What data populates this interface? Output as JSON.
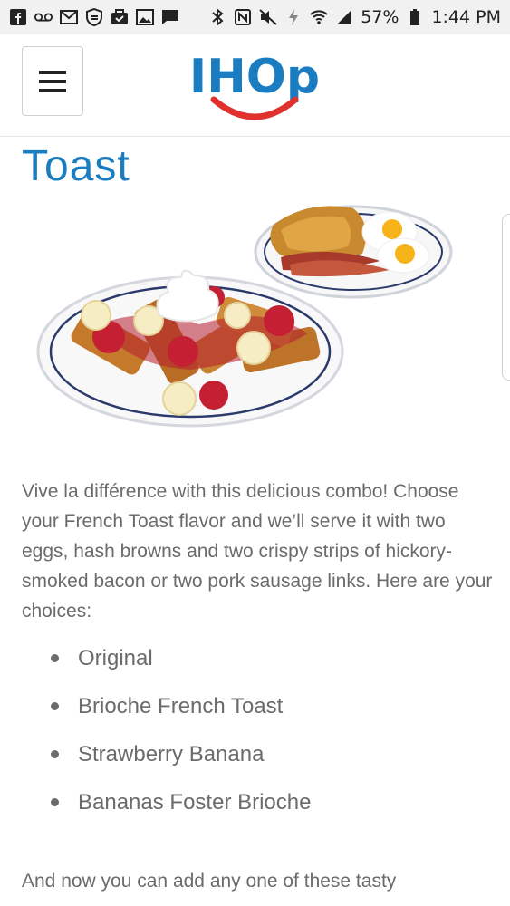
{
  "status_bar": {
    "left_icons": [
      "facebook-icon",
      "voicemail-icon",
      "gmail-icon",
      "shield-icon",
      "briefcase-check-icon",
      "gallery-icon",
      "message-icon"
    ],
    "right_icons": [
      "bluetooth-icon",
      "nfc-icon",
      "mute-icon",
      "data-icon",
      "wifi-icon",
      "signal-icon",
      "battery-icon"
    ],
    "battery": "57%",
    "time": "1:44 PM"
  },
  "header": {
    "logo_text": "IHOp",
    "menu_label": "menu"
  },
  "page": {
    "title": "Toast",
    "description": "Vive la différence with this delicious combo! Choose your French Toast flavor and we’ll serve it with two eggs, hash browns and two crispy strips of hickory-smoked bacon or two pork sausage links. Here are your choices:",
    "choices": [
      "Original",
      "Brioche French Toast",
      "Strawberry Banana",
      "Bananas Foster Brioche"
    ],
    "more_text_line1": "And now you can add any one of these tasty",
    "more_text_line2": ""
  },
  "colors": {
    "brand_blue": "#1a7cc1",
    "brand_red": "#e0312f",
    "body_text": "#6b6b6b",
    "status_bar_bg": "#f1f1f1"
  }
}
